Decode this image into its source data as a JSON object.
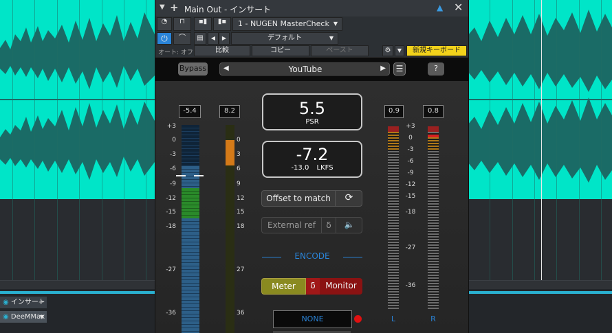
{
  "header": {
    "title": "Main Out - インサート",
    "plugin_slot": "1 - NUGEN MasterCheck",
    "preset": "デフォルト",
    "auto_label": "オート: オフ",
    "compare_label": "比較",
    "copy_label": "コピー",
    "paste_label": "ペースト",
    "new_keyboard_label": "新規キーボード"
  },
  "plugin": {
    "bypass_label": "Bypass",
    "target_preset": "YouTube",
    "help_label": "?",
    "left_meter_value": "-5.4",
    "right_meter_value": "8.2",
    "psr_value": "5.5",
    "psr_label": "PSR",
    "lkfs_value": "-7.2",
    "lkfs_sub": "-13.0",
    "lkfs_label": "LKFS",
    "offset_label": "Offset to match",
    "external_ref_label": "External ref",
    "delta_label": "δ",
    "encode_label": "ENCODE",
    "meter_label": "Meter",
    "monitor_label": "Monitor",
    "codec_label": "NONE",
    "peak_l_value": "0.9",
    "peak_r_value": "0.8",
    "channel_l": "L",
    "channel_r": "R",
    "scale_left": [
      "+3",
      "0",
      "-3",
      "-6",
      "-9",
      "-12",
      "-15",
      "-18",
      "-27",
      "-36"
    ],
    "scale_mid": [
      "0",
      "3",
      "6",
      "9",
      "12",
      "15",
      "18",
      "27",
      "36"
    ],
    "scale_right": [
      "+3",
      "0",
      "-3",
      "-6",
      "-9",
      "-12",
      "-15",
      "-18",
      "-27",
      "-36"
    ]
  },
  "daw": {
    "inspector_insert": "インサート",
    "inspector_plugin": "DeeMMax"
  },
  "colors": {
    "waveform_bg": "#00e5c8",
    "waveform": "#1a6b66",
    "accent_blue": "#2a84d8",
    "meter_green": "#2a8a2a",
    "meter_orange": "#d47a18",
    "monitor_red": "#8a1212",
    "meter_yellow": "#8a8a20",
    "keyboard_yellow": "#f2d21b"
  }
}
